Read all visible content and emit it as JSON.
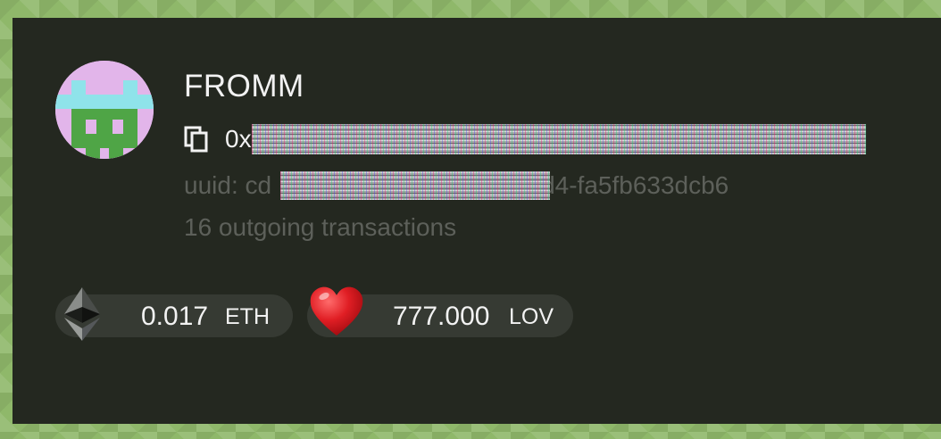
{
  "profile": {
    "name": "FROMM",
    "address_prefix": "0x",
    "uuid_prefix": "uuid: cd",
    "uuid_suffix": "d4-fa5fb633dcb6",
    "transactions": "16 outgoing transactions"
  },
  "balances": [
    {
      "value": "0.017",
      "unit": "ETH",
      "icon": "ethereum-icon"
    },
    {
      "value": "777.000",
      "unit": "LOV",
      "icon": "heart-icon"
    }
  ],
  "icons": {
    "copy": "copy-icon",
    "avatar": "pixel-avatar"
  },
  "colors": {
    "page_background": "#8fb86a",
    "card_background": "#242820",
    "pill_background": "#363a33",
    "primary_text": "#f2f2f2",
    "muted_text": "#5d605a",
    "avatar_pink": "#e2b5ea",
    "avatar_green": "#4fa546",
    "avatar_cyan": "#8fe3ea",
    "heart_red": "#e01e24"
  }
}
